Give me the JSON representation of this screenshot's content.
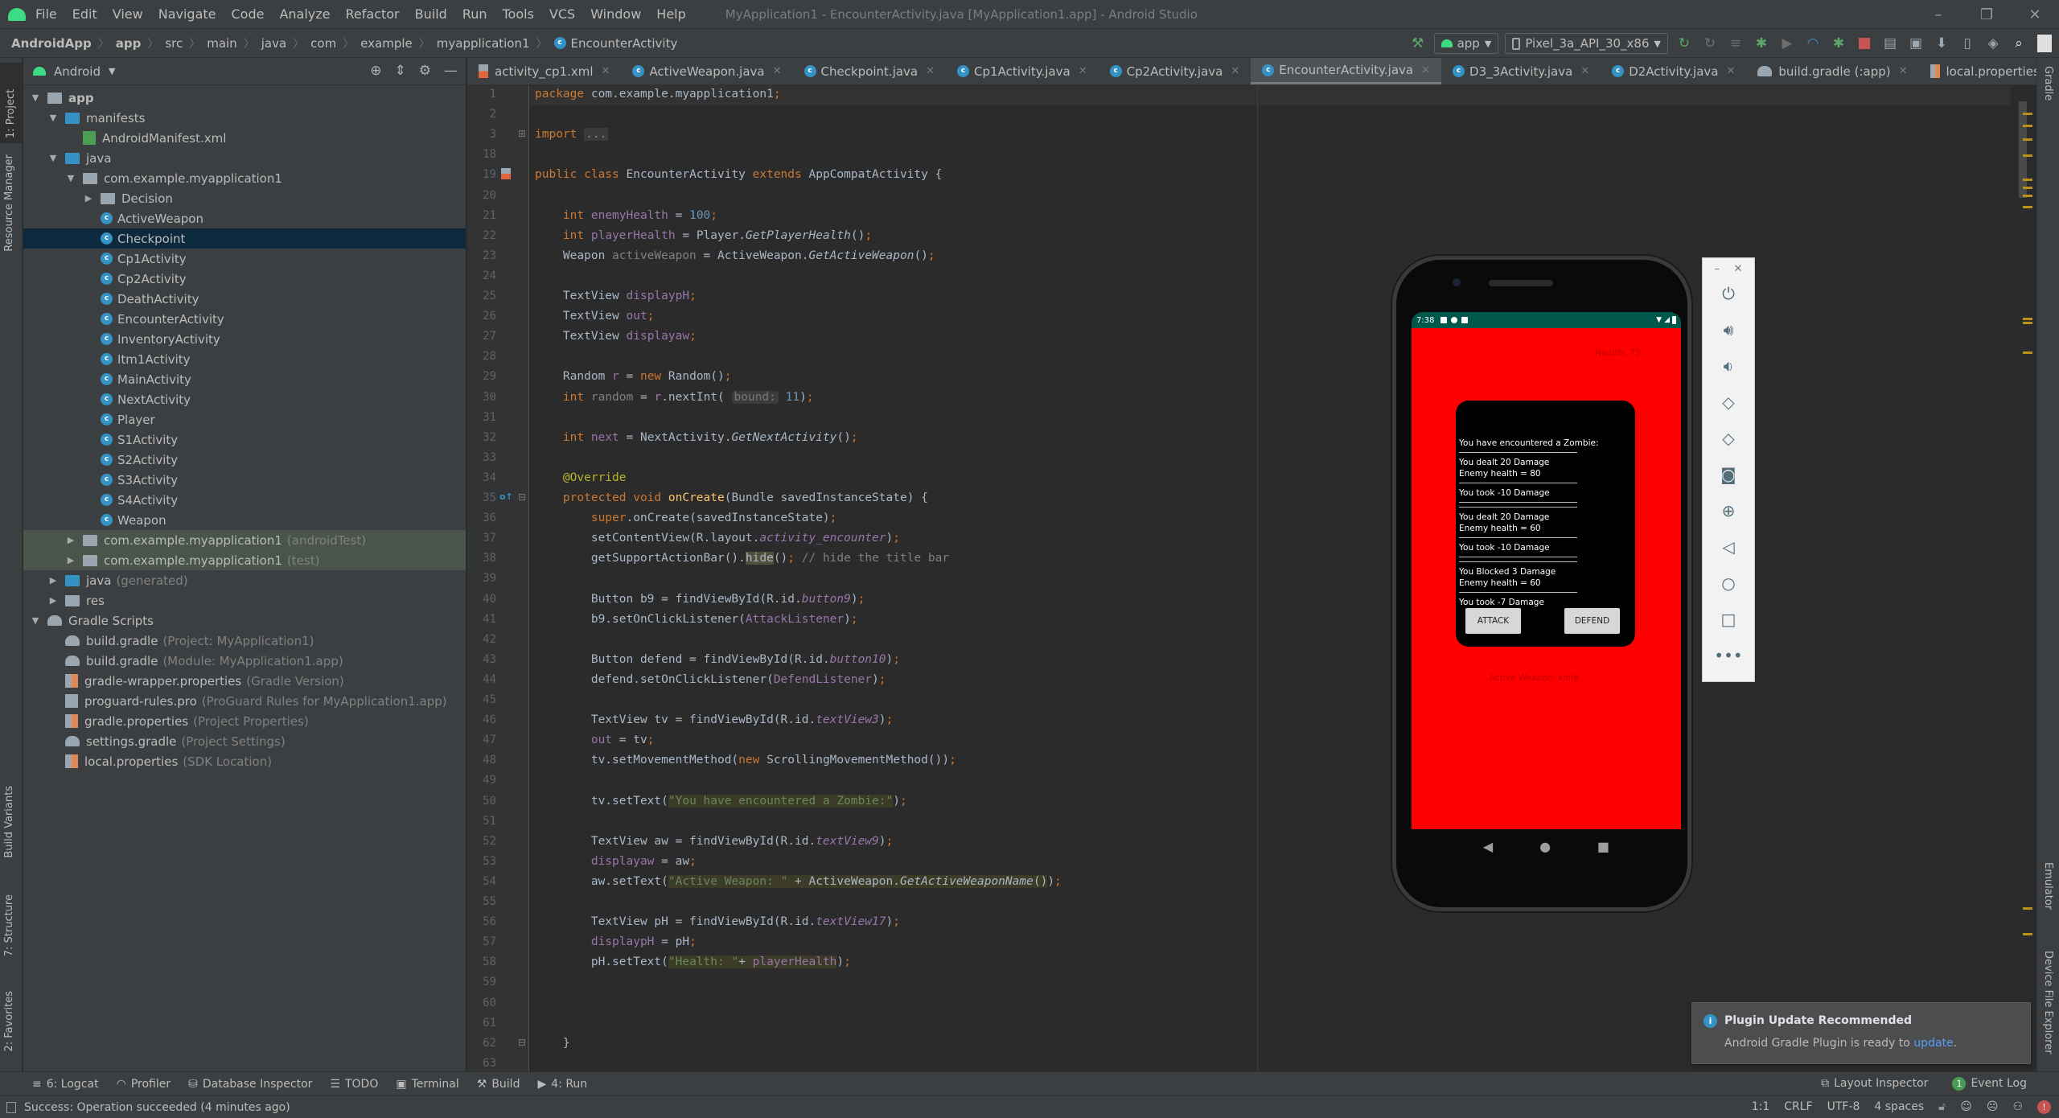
{
  "menu": {
    "items": [
      "File",
      "Edit",
      "View",
      "Navigate",
      "Code",
      "Analyze",
      "Refactor",
      "Build",
      "Run",
      "Tools",
      "VCS",
      "Window",
      "Help"
    ],
    "window_title": "MyApplication1 - EncounterActivity.java [MyApplication1.app] - Android Studio"
  },
  "window_controls": {
    "minimize": "–",
    "restore": "❐",
    "close": "✕"
  },
  "breadcrumb": [
    "AndroidApp",
    "app",
    "src",
    "main",
    "java",
    "com",
    "example",
    "myapplication1",
    "EncounterActivity"
  ],
  "toolbar": {
    "run_config": "app",
    "device": "Pixel_3a_API_30_x86"
  },
  "left_strip": {
    "project": "1: Project",
    "resource_manager": "Resource Manager",
    "build_variants": "Build Variants",
    "structure": "7: Structure",
    "favorites": "2: Favorites"
  },
  "right_strip": {
    "gradle": "Gradle",
    "emulator": "Emulator",
    "device_file_explorer": "Device File Explorer"
  },
  "project": {
    "view_mode": "Android",
    "tree": [
      {
        "label": "app",
        "indent": 0,
        "arrow": "▼",
        "icon": "module",
        "bold": true
      },
      {
        "label": "manifests",
        "indent": 1,
        "arrow": "▼",
        "icon": "folder"
      },
      {
        "label": "AndroidManifest.xml",
        "indent": 2,
        "arrow": "",
        "icon": "manifest"
      },
      {
        "label": "java",
        "indent": 1,
        "arrow": "▼",
        "icon": "folder"
      },
      {
        "label": "com.example.myapplication1",
        "indent": 2,
        "arrow": "▼",
        "icon": "package"
      },
      {
        "label": "Decision",
        "indent": 3,
        "arrow": "▶",
        "icon": "package"
      },
      {
        "label": "ActiveWeapon",
        "indent": 3,
        "arrow": "",
        "icon": "class"
      },
      {
        "label": "Checkpoint",
        "indent": 3,
        "arrow": "",
        "icon": "class",
        "selected": true
      },
      {
        "label": "Cp1Activity",
        "indent": 3,
        "arrow": "",
        "icon": "class"
      },
      {
        "label": "Cp2Activity",
        "indent": 3,
        "arrow": "",
        "icon": "class"
      },
      {
        "label": "DeathActivity",
        "indent": 3,
        "arrow": "",
        "icon": "class"
      },
      {
        "label": "EncounterActivity",
        "indent": 3,
        "arrow": "",
        "icon": "class"
      },
      {
        "label": "InventoryActivity",
        "indent": 3,
        "arrow": "",
        "icon": "class"
      },
      {
        "label": "Itm1Activity",
        "indent": 3,
        "arrow": "",
        "icon": "class"
      },
      {
        "label": "MainActivity",
        "indent": 3,
        "arrow": "",
        "icon": "class"
      },
      {
        "label": "NextActivity",
        "indent": 3,
        "arrow": "",
        "icon": "class"
      },
      {
        "label": "Player",
        "indent": 3,
        "arrow": "",
        "icon": "class"
      },
      {
        "label": "S1Activity",
        "indent": 3,
        "arrow": "",
        "icon": "class"
      },
      {
        "label": "S2Activity",
        "indent": 3,
        "arrow": "",
        "icon": "class"
      },
      {
        "label": "S3Activity",
        "indent": 3,
        "arrow": "",
        "icon": "class"
      },
      {
        "label": "S4Activity",
        "indent": 3,
        "arrow": "",
        "icon": "class"
      },
      {
        "label": "Weapon",
        "indent": 3,
        "arrow": "",
        "icon": "class"
      },
      {
        "label": "com.example.myapplication1",
        "hint": "(androidTest)",
        "indent": 2,
        "arrow": "▶",
        "icon": "package",
        "test": true
      },
      {
        "label": "com.example.myapplication1",
        "hint": "(test)",
        "indent": 2,
        "arrow": "▶",
        "icon": "package",
        "test": true
      },
      {
        "label": "java",
        "hint": "(generated)",
        "indent": 1,
        "arrow": "▶",
        "icon": "folder"
      },
      {
        "label": "res",
        "indent": 1,
        "arrow": "▶",
        "icon": "res"
      },
      {
        "label": "Gradle Scripts",
        "indent": 0,
        "arrow": "▼",
        "icon": "gradle"
      },
      {
        "label": "build.gradle",
        "hint": "(Project: MyApplication1)",
        "indent": 1,
        "arrow": "",
        "icon": "gradle"
      },
      {
        "label": "build.gradle",
        "hint": "(Module: MyApplication1.app)",
        "indent": 1,
        "arrow": "",
        "icon": "gradle"
      },
      {
        "label": "gradle-wrapper.properties",
        "hint": "(Gradle Version)",
        "indent": 1,
        "arrow": "",
        "icon": "props"
      },
      {
        "label": "proguard-rules.pro",
        "hint": "(ProGuard Rules for MyApplication1.app)",
        "indent": 1,
        "arrow": "",
        "icon": "file"
      },
      {
        "label": "gradle.properties",
        "hint": "(Project Properties)",
        "indent": 1,
        "arrow": "",
        "icon": "props"
      },
      {
        "label": "settings.gradle",
        "hint": "(Project Settings)",
        "indent": 1,
        "arrow": "",
        "icon": "gradle"
      },
      {
        "label": "local.properties",
        "hint": "(SDK Location)",
        "indent": 1,
        "arrow": "",
        "icon": "props"
      }
    ]
  },
  "tabs": [
    {
      "label": "activity_cp1.xml",
      "icon": "xml"
    },
    {
      "label": "ActiveWeapon.java",
      "icon": "class"
    },
    {
      "label": "Checkpoint.java",
      "icon": "class"
    },
    {
      "label": "Cp1Activity.java",
      "icon": "class"
    },
    {
      "label": "Cp2Activity.java",
      "icon": "class"
    },
    {
      "label": "EncounterActivity.java",
      "icon": "class",
      "active": true
    },
    {
      "label": "D3_3Activity.java",
      "icon": "class"
    },
    {
      "label": "D2Activity.java",
      "icon": "class"
    },
    {
      "label": "build.gradle (:app)",
      "icon": "gradle"
    },
    {
      "label": "local.properties",
      "icon": "props"
    }
  ],
  "editor": {
    "line_numbers": [
      1,
      2,
      3,
      18,
      19,
      20,
      21,
      22,
      23,
      24,
      25,
      26,
      27,
      28,
      29,
      30,
      31,
      32,
      33,
      34,
      35,
      36,
      37,
      38,
      39,
      40,
      41,
      42,
      43,
      44,
      45,
      46,
      47,
      48,
      49,
      50,
      51,
      52,
      53,
      54,
      55,
      56,
      57,
      58,
      59,
      60,
      61,
      62,
      63
    ],
    "lines": [
      "<span class='kw'>package</span> com.example.myapplication1<span class='kw'>;</span>",
      "",
      "<span class='kw'>import</span> <span class='fold-box'>...</span>",
      "",
      "<span class='kw'>public class</span> EncounterActivity <span class='kw'>extends</span> AppCompatActivity {",
      "",
      "    <span class='kw'>int</span> <span class='fld'>enemyHealth</span> = <span class='num'>100</span><span class='kw'>;</span>",
      "    <span class='kw'>int</span> <span class='fld'>playerHealth</span> = Player.<span class='it'>GetPlayerHealth</span>()<span class='kw'>;</span>",
      "    Weapon <span class='grey-fld'>activeWeapon</span> = ActiveWeapon.<span class='it'>GetActiveWeapon</span>()<span class='kw'>;</span>",
      "",
      "    TextView <span class='fld'>displaypH</span><span class='kw'>;</span>",
      "    TextView <span class='fld'>out</span><span class='kw'>;</span>",
      "    TextView <span class='fld'>displayaw</span><span class='kw'>;</span>",
      "",
      "    Random <span class='fld'>r</span> = <span class='kw'>new</span> Random()<span class='kw'>;</span>",
      "    <span class='kw'>int</span> <span class='grey-fld'>random</span> = <span class='fld'>r</span>.nextInt( <span class='param-hint'>bound:</span> <span class='num'>11</span>)<span class='kw'>;</span>",
      "",
      "    <span class='kw'>int</span> <span class='fld'>next</span> = NextActivity.<span class='it'>GetNextActivity</span>()<span class='kw'>;</span>",
      "",
      "    <span class='ann'>@Override</span>",
      "    <span class='kw'>protected void</span> <span class='fn'>onCreate</span>(Bundle savedInstanceState) {",
      "        <span class='kw'>super</span>.onCreate(savedInstanceState)<span class='kw'>;</span>",
      "        setContentView(R.layout.<span class='fld it'>activity_encounter</span>)<span class='kw'>;</span>",
      "        getSupportActionBar().<span class='hl2'>hide</span>()<span class='kw'>;</span> <span class='cmt'>// hide the title bar</span>",
      "",
      "        Button b9 = findViewById(R.id.<span class='fld it'>button9</span>)<span class='kw'>;</span>",
      "        b9.setOnClickListener(<span class='fld'>AttackListener</span>)<span class='kw'>;</span>",
      "",
      "        Button defend = findViewById(R.id.<span class='fld it'>button10</span>)<span class='kw'>;</span>",
      "        defend.setOnClickListener(<span class='fld'>DefendListener</span>)<span class='kw'>;</span>",
      "",
      "        TextView tv = findViewById(R.id.<span class='fld it'>textView3</span>)<span class='kw'>;</span>",
      "        <span class='fld'>out</span> = tv<span class='kw'>;</span>",
      "        tv.setMovementMethod(<span class='kw'>new</span> ScrollingMovementMethod())<span class='kw'>;</span>",
      "",
      "        tv.setText(<span class='hl'><span class='str'>\"You have encountered a Zombie:\"</span></span>)<span class='kw'>;</span>",
      "",
      "        TextView aw = findViewById(R.id.<span class='fld it'>textView9</span>)<span class='kw'>;</span>",
      "        <span class='fld'>displayaw</span> = aw<span class='kw'>;</span>",
      "        aw.setText(<span class='hl'><span class='str'>\"Active Weapon: \"</span> + ActiveWeapon.<span class='it'>GetActiveWeaponName</span>()</span>)<span class='kw'>;</span>",
      "",
      "        TextView pH = findViewById(R.id.<span class='fld it'>textView17</span>)<span class='kw'>;</span>",
      "        <span class='fld'>displaypH</span> = pH<span class='kw'>;</span>",
      "        pH.setText(<span class='hl'><span class='str'>\"Health: \"</span>+ <span class='fld'>playerHealth</span></span>)<span class='kw'>;</span>",
      "",
      "",
      "",
      "    }",
      ""
    ]
  },
  "emulator": {
    "status_time": "7:38",
    "health_label": "Health: 73",
    "log": [
      {
        "type": "text",
        "text": "You have encountered a Zombie:"
      },
      {
        "type": "sep"
      },
      {
        "type": "text",
        "text": "You dealt 20 Damage"
      },
      {
        "type": "text",
        "text": "Enemy health = 80"
      },
      {
        "type": "sep"
      },
      {
        "type": "text",
        "text": "You took -10 Damage"
      },
      {
        "type": "sep"
      },
      {
        "type": "sep"
      },
      {
        "type": "text",
        "text": "You dealt 20 Damage"
      },
      {
        "type": "text",
        "text": "Enemy health = 60"
      },
      {
        "type": "sep"
      },
      {
        "type": "text",
        "text": "You took -10 Damage"
      },
      {
        "type": "sep"
      },
      {
        "type": "sep"
      },
      {
        "type": "text",
        "text": "You Blocked 3 Damage"
      },
      {
        "type": "text",
        "text": "Enemy health = 60"
      },
      {
        "type": "sep"
      },
      {
        "type": "text",
        "text": "You took -7 Damage"
      }
    ],
    "attack_label": "ATTACK",
    "defend_label": "DEFEND",
    "active_weapon": "Active Weapon: knife",
    "background_color": "#ff0000",
    "status_bar_color": "#00574b"
  },
  "emulator_panel": {
    "buttons": [
      "power-icon",
      "volume-up-icon",
      "volume-down-icon",
      "rotate-left-icon",
      "rotate-right-icon",
      "camera-icon",
      "zoom-icon",
      "back-icon",
      "home-icon",
      "overview-icon",
      "more-icon"
    ]
  },
  "bottom_tabs": [
    "6: Logcat",
    "Profiler",
    "Database Inspector",
    "TODO",
    "Terminal",
    "Build",
    "4: Run"
  ],
  "bottom_right": {
    "layout_inspector": "Layout Inspector",
    "event_log": "Event Log",
    "event_count": "1"
  },
  "status": {
    "message": "Success: Operation succeeded (4 minutes ago)",
    "position": "1:1",
    "line_sep": "CRLF",
    "encoding": "UTF-8",
    "indent": "4 spaces"
  },
  "notification": {
    "title": "Plugin Update Recommended",
    "body": "Android Gradle Plugin is ready to ",
    "link": "update",
    "suffix": "."
  }
}
